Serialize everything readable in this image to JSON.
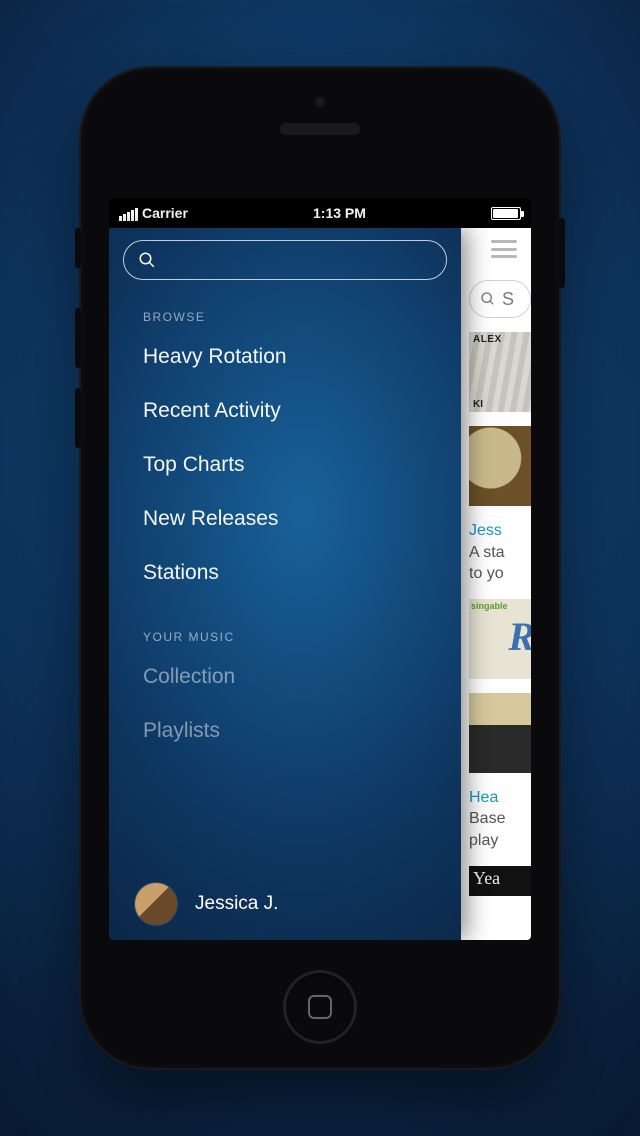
{
  "status": {
    "carrier": "Carrier",
    "time": "1:13 PM"
  },
  "drawer": {
    "sections": [
      {
        "label": "BROWSE",
        "items": [
          "Heavy Rotation",
          "Recent Activity",
          "Top Charts",
          "New Releases",
          "Stations"
        ],
        "active_index": 4
      },
      {
        "label": "YOUR MUSIC",
        "items": [
          "Collection",
          "Playlists"
        ]
      }
    ],
    "profile": {
      "name": "Jessica J."
    }
  },
  "under": {
    "search_prefix": "S",
    "album1_top": "ALEX",
    "blurb1_title": "Jess",
    "blurb1_line1": "A sta",
    "blurb1_line2": "to yo",
    "album3_tag": "singable",
    "album3_letter": "R",
    "blurb2_title": "Hea",
    "blurb2_line1": "Base",
    "blurb2_line2": "play",
    "album5_script": "Yea"
  }
}
